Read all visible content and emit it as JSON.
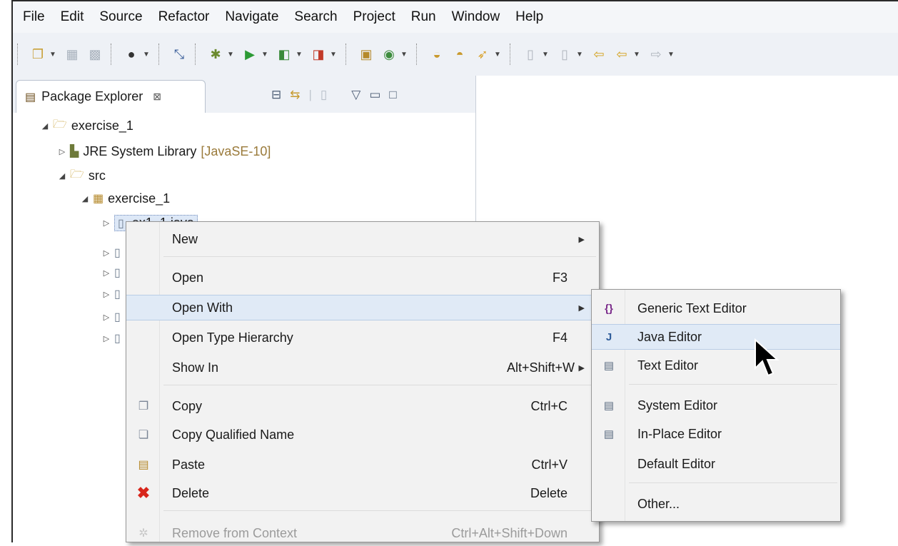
{
  "menubar": [
    "File",
    "Edit",
    "Source",
    "Refactor",
    "Navigate",
    "Search",
    "Project",
    "Run",
    "Window",
    "Help"
  ],
  "toolbar_icons": [
    "new-icon",
    "save-icon",
    "save-all-icon",
    "account-icon",
    "skip-breakpoints-icon",
    "debug-icon",
    "run-icon",
    "coverage-icon",
    "external-tools-icon",
    "new-java-package-icon",
    "new-java-class-icon",
    "open-type-icon",
    "open-task-icon",
    "search-icon",
    "annotation-icon",
    "back-icon",
    "forward-icon"
  ],
  "view": {
    "tab_title": "Package Explorer",
    "tab_close": "⊠"
  },
  "tree": {
    "project": "exercise_1",
    "jre": "JRE System Library",
    "jre_deco": "[JavaSE-10]",
    "src": "src",
    "package": "exercise_1",
    "selected_file": "ex1_1.java"
  },
  "context_menu": {
    "new": "New",
    "open": "Open",
    "open_acc": "F3",
    "open_with": "Open With",
    "open_type_hierarchy": "Open Type Hierarchy",
    "open_type_hierarchy_acc": "F4",
    "show_in": "Show In",
    "show_in_acc": "Alt+Shift+W",
    "copy": "Copy",
    "copy_acc": "Ctrl+C",
    "copy_qualified_name": "Copy Qualified Name",
    "paste": "Paste",
    "paste_acc": "Ctrl+V",
    "delete": "Delete",
    "delete_acc": "Delete",
    "remove_from_context": "Remove from Context",
    "remove_from_context_acc": "Ctrl+Alt+Shift+Down"
  },
  "submenu": {
    "generic_text_editor": "Generic Text Editor",
    "java_editor": "Java Editor",
    "text_editor": "Text Editor",
    "system_editor": "System Editor",
    "in_place_editor": "In-Place Editor",
    "default_editor": "Default Editor",
    "other": "Other..."
  }
}
